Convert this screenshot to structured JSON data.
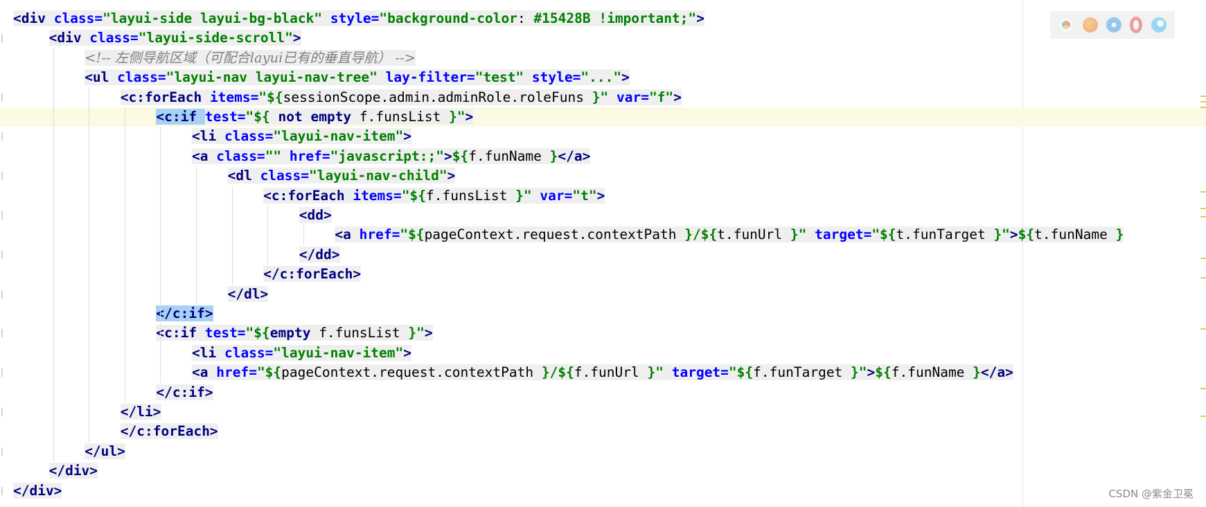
{
  "lines": [
    {
      "segments": [
        [
          "t",
          "<div "
        ],
        [
          "a",
          "class="
        ],
        [
          "v",
          "\"layui-side layui-bg-black\" "
        ],
        [
          "a",
          "style="
        ],
        [
          "v",
          "\"background-color"
        ],
        [
          "e",
          ": "
        ],
        [
          "v",
          "#15428B !important;\""
        ],
        [
          "t",
          ">"
        ]
      ],
      "bg": [
        0,
        1
      ]
    },
    {
      "segments": [
        [
          "t",
          "<div "
        ],
        [
          "a",
          "class="
        ],
        [
          "v",
          "\"layui-side-scroll\""
        ],
        [
          "t",
          ">"
        ]
      ],
      "bg": [
        1,
        1
      ]
    },
    {
      "segments": [
        [
          "c",
          "<!-- 左侧导航区域（可配合layui已有的垂直导航） -->"
        ]
      ],
      "bg": [
        2,
        2
      ]
    },
    {
      "segments": [
        [
          "t",
          "<ul "
        ],
        [
          "a",
          "class="
        ],
        [
          "v",
          "\"layui-nav layui-nav-tree\" "
        ],
        [
          "a",
          "lay-filter="
        ],
        [
          "v",
          "\"test\" "
        ],
        [
          "a",
          "style="
        ],
        [
          "v",
          "\"...\""
        ],
        [
          "t",
          ">"
        ]
      ],
      "bg": [
        3,
        3
      ]
    },
    {
      "segments": [
        [
          "t",
          "<c:forEach "
        ],
        [
          "a",
          "items="
        ],
        [
          "v",
          "\"${"
        ],
        [
          "e",
          "sessionScope.admin.adminRole.roleFuns "
        ],
        [
          "v",
          "}\" "
        ],
        [
          "a",
          "var="
        ],
        [
          "v",
          "\"f\""
        ],
        [
          "t",
          ">"
        ]
      ],
      "bg": [
        4,
        4
      ]
    },
    {
      "segments": [
        [
          "t",
          "<c:if "
        ],
        [
          "a",
          "test="
        ],
        [
          "v",
          "\"${ "
        ],
        [
          "t",
          "not empty "
        ],
        [
          "e",
          "f.funsList "
        ],
        [
          "v",
          "}\""
        ],
        [
          "t",
          ">"
        ]
      ],
      "bg": [
        5,
        5
      ],
      "current": true,
      "hl": [
        0,
        0
      ]
    },
    {
      "segments": [
        [
          "t",
          "<li "
        ],
        [
          "a",
          "class="
        ],
        [
          "v",
          "\"layui-nav-item\""
        ],
        [
          "t",
          ">"
        ]
      ],
      "bg": [
        6,
        6
      ]
    },
    {
      "segments": [
        [
          "t",
          "<a "
        ],
        [
          "a",
          "class="
        ],
        [
          "v",
          "\"\" "
        ],
        [
          "a",
          "href="
        ],
        [
          "v",
          "\"javascript:;\""
        ],
        [
          "t",
          ">"
        ],
        [
          "v",
          "${"
        ],
        [
          "e",
          "f.funName "
        ],
        [
          "v",
          "}"
        ],
        [
          "t",
          "</a>"
        ]
      ],
      "bg": [
        7,
        7
      ]
    },
    {
      "segments": [
        [
          "t",
          "<dl "
        ],
        [
          "a",
          "class="
        ],
        [
          "v",
          "\"layui-nav-child\""
        ],
        [
          "t",
          ">"
        ]
      ],
      "bg": [
        8,
        8
      ]
    },
    {
      "segments": [
        [
          "t",
          "<c:forEach "
        ],
        [
          "a",
          "items="
        ],
        [
          "v",
          "\"${"
        ],
        [
          "e",
          "f.funsList "
        ],
        [
          "v",
          "}\" "
        ],
        [
          "a",
          "var="
        ],
        [
          "v",
          "\"t\""
        ],
        [
          "t",
          ">"
        ]
      ],
      "bg": [
        9,
        9
      ]
    },
    {
      "segments": [
        [
          "t",
          "<dd>"
        ]
      ],
      "bg": [
        10,
        10
      ]
    },
    {
      "segments": [
        [
          "t",
          "<a "
        ],
        [
          "a",
          "href="
        ],
        [
          "v",
          "\"${"
        ],
        [
          "e",
          "pageContext.request.contextPath "
        ],
        [
          "v",
          "}/${"
        ],
        [
          "e",
          "t.funUrl "
        ],
        [
          "v",
          "}\" "
        ],
        [
          "a",
          "target="
        ],
        [
          "v",
          "\"${"
        ],
        [
          "e",
          "t.funTarget "
        ],
        [
          "v",
          "}\""
        ],
        [
          "t",
          ">"
        ],
        [
          "v",
          "${"
        ],
        [
          "e",
          "t.funName "
        ],
        [
          "v",
          "}"
        ]
      ],
      "bg": [
        11,
        11
      ]
    },
    {
      "segments": [
        [
          "t",
          "</dd>"
        ]
      ],
      "bg": [
        12,
        12
      ]
    },
    {
      "segments": [
        [
          "t",
          "</c:forEach>"
        ]
      ],
      "bg": [
        13,
        13
      ]
    },
    {
      "segments": [
        [
          "t",
          "</dl>"
        ]
      ],
      "bg": [
        14,
        14
      ]
    },
    {
      "segments": [
        [
          "t",
          "</c:if>"
        ]
      ],
      "bg": [
        15,
        15
      ],
      "hl": [
        0,
        0
      ]
    },
    {
      "segments": [
        [
          "t",
          "<c:if "
        ],
        [
          "a",
          "test="
        ],
        [
          "v",
          "\"${"
        ],
        [
          "t",
          "empty "
        ],
        [
          "e",
          "f.funsList "
        ],
        [
          "v",
          "}\""
        ],
        [
          "t",
          ">"
        ]
      ],
      "bg": [
        16,
        16
      ]
    },
    {
      "segments": [
        [
          "t",
          "<li "
        ],
        [
          "a",
          "class="
        ],
        [
          "v",
          "\"layui-nav-item\""
        ],
        [
          "t",
          ">"
        ]
      ],
      "bg": [
        17,
        17
      ]
    },
    {
      "segments": [
        [
          "t",
          "<a "
        ],
        [
          "a",
          "href="
        ],
        [
          "v",
          "\"${"
        ],
        [
          "e",
          "pageContext.request.contextPath "
        ],
        [
          "v",
          "}/${"
        ],
        [
          "e",
          "f.funUrl "
        ],
        [
          "v",
          "}\" "
        ],
        [
          "a",
          "target="
        ],
        [
          "v",
          "\"${"
        ],
        [
          "e",
          "f.funTarget "
        ],
        [
          "v",
          "}\""
        ],
        [
          "t",
          ">"
        ],
        [
          "v",
          "${"
        ],
        [
          "e",
          "f.funName "
        ],
        [
          "v",
          "}"
        ],
        [
          "t",
          "</a>"
        ]
      ],
      "bg": [
        18,
        18
      ]
    },
    {
      "segments": [
        [
          "t",
          "</c:if>"
        ]
      ],
      "bg": [
        19,
        19
      ]
    },
    {
      "segments": [
        [
          "t",
          "</li>"
        ]
      ],
      "bg": [
        20,
        20
      ]
    },
    {
      "segments": [
        [
          "t",
          "</c:forEach>"
        ]
      ],
      "bg": [
        21,
        21
      ]
    },
    {
      "segments": [
        [
          "t",
          "</ul>"
        ]
      ],
      "bg": [
        22,
        22
      ]
    },
    {
      "segments": [
        [
          "t",
          "</div>"
        ]
      ],
      "bg": [
        23,
        23
      ]
    },
    {
      "segments": [
        [
          "t",
          "</div>"
        ]
      ],
      "bg": [
        24,
        24
      ]
    }
  ],
  "watermark": "CSDN @紫金卫冕",
  "browser_icons": [
    "chrome-icon",
    "firefox-icon",
    "safari-icon",
    "opera-icon",
    "edge-icon"
  ],
  "colors": {
    "tag": "#000080",
    "attr": "#0000ff",
    "value": "#008000",
    "comment": "#808080",
    "caret_line": "#fcfae5",
    "selection": "#a8d1f5"
  }
}
